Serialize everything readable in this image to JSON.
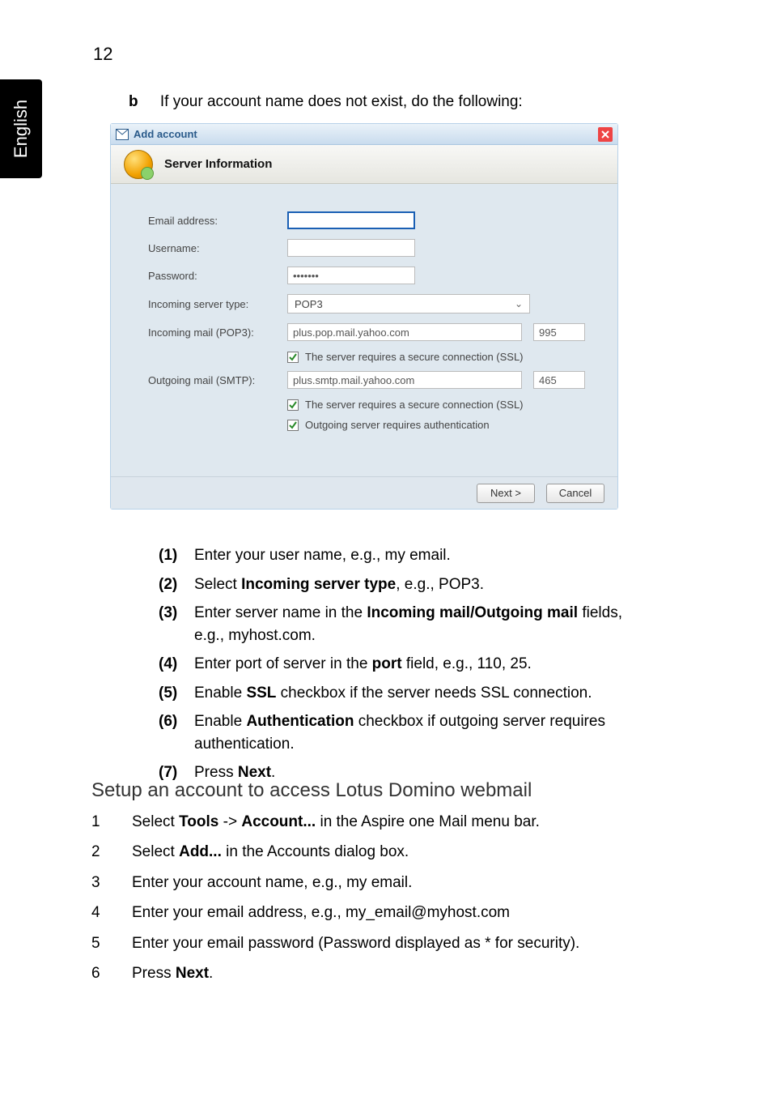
{
  "page": {
    "number": "12",
    "lang_tab": "English"
  },
  "intro": {
    "marker": "b",
    "text": "If your account name does not exist, do the following:"
  },
  "dialog": {
    "title": "Add account",
    "section": "Server Information",
    "labels": {
      "email": "Email address:",
      "username": "Username:",
      "password": "Password:",
      "in_type": "Incoming server type:",
      "in_mail": "Incoming mail (POP3):",
      "out_mail": "Outgoing mail (SMTP):"
    },
    "values": {
      "email": "",
      "username": "",
      "password": "•••••••",
      "in_type": "POP3",
      "in_mail_host": "plus.pop.mail.yahoo.com",
      "in_mail_port": "995",
      "out_mail_host": "plus.smtp.mail.yahoo.com",
      "out_mail_port": "465"
    },
    "checks": {
      "ssl1": "The server requires a secure connection (SSL)",
      "ssl2": "The server requires a secure connection (SSL)",
      "auth": "Outgoing server requires authentication"
    },
    "buttons": {
      "next": "Next >",
      "cancel": "Cancel"
    }
  },
  "steps_inner": [
    {
      "n": "(1)",
      "pre": "Enter your user name, e.g., my email."
    },
    {
      "n": "(2)",
      "pre": "Select ",
      "b": "Incoming server type",
      "post": ", e.g., POP3."
    },
    {
      "n": "(3)",
      "pre": "Enter server name in the ",
      "b": "Incoming mail/Outgoing mail",
      "post": " fields, e.g., myhost.com."
    },
    {
      "n": "(4)",
      "pre": "Enter port of server in the ",
      "b": "port",
      "post": " field, e.g., 110, 25."
    },
    {
      "n": "(5)",
      "pre": "Enable ",
      "b": "SSL",
      "post": " checkbox if the server needs SSL connection."
    },
    {
      "n": "(6)",
      "pre": "Enable ",
      "b": "Authentication",
      "post": " checkbox if outgoing server requires authentication."
    },
    {
      "n": "(7)",
      "pre": "Press ",
      "b": "Next",
      "post": "."
    }
  ],
  "heading2": "Setup an account to access Lotus Domino webmail",
  "steps_outer": [
    {
      "n": "1",
      "pre": "Select ",
      "b": "Tools",
      "mid": " -> ",
      "b2": "Account...",
      "post": " in the Aspire one Mail menu bar."
    },
    {
      "n": "2",
      "pre": "Select ",
      "b": "Add...",
      "post": " in the Accounts dialog box."
    },
    {
      "n": "3",
      "pre": "Enter your account name, e.g., my email."
    },
    {
      "n": "4",
      "pre": "Enter your email address, e.g., my_email@myhost.com"
    },
    {
      "n": "5",
      "pre": "Enter your email password (Password displayed as * for security)."
    },
    {
      "n": "6",
      "pre": "Press ",
      "b": "Next",
      "post": "."
    }
  ]
}
